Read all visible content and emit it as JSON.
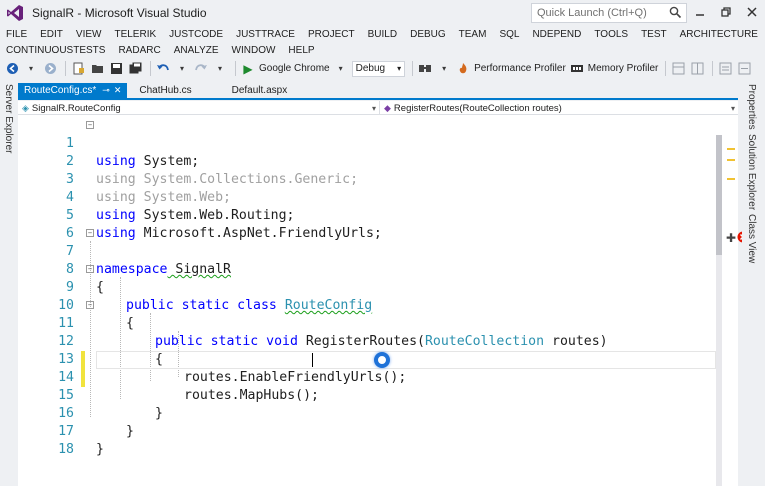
{
  "window": {
    "title": "SignalR - Microsoft Visual Studio",
    "quick_launch_placeholder": "Quick Launch (Ctrl+Q)",
    "controls": [
      "minimize",
      "restore",
      "close"
    ]
  },
  "menu": {
    "row1": [
      "FILE",
      "EDIT",
      "VIEW",
      "TELERIK",
      "JUSTCODE",
      "JUSTTRACE",
      "PROJECT",
      "BUILD",
      "DEBUG",
      "TEAM",
      "SQL",
      "NDEPEND",
      "TOOLS",
      "TEST",
      "ARCHITECTURE"
    ],
    "row2": [
      "CONTINUOUSTESTS",
      "RADARC",
      "ANALYZE",
      "WINDOW",
      "HELP"
    ]
  },
  "toolbar": {
    "browser": "Google Chrome",
    "config": "Debug",
    "perf_profiler": "Performance Profiler",
    "mem_profiler": "Memory Profiler"
  },
  "side_tabs": {
    "left": [
      "Server Explorer"
    ],
    "right": [
      "Properties",
      "Solution Explorer",
      "Class View"
    ]
  },
  "tabs": [
    {
      "label": "RouteConfig.cs*",
      "active": true
    },
    {
      "label": "ChatHub.cs",
      "active": false
    },
    {
      "label": "Default.aspx",
      "active": false
    }
  ],
  "nav": {
    "type_combo": "SignalR.RouteConfig",
    "member_combo": "RegisterRoutes(RouteCollection routes)"
  },
  "code": {
    "line_numbers": [
      "1",
      "2",
      "3",
      "4",
      "5",
      "6",
      "7",
      "8",
      "9",
      "10",
      "11",
      "12",
      "13",
      "14",
      "15",
      "16",
      "17",
      "18"
    ],
    "l1_kw": "using",
    "l1_rest": " System;",
    "l2": "using System.Collections.Generic;",
    "l3": "using System.Web;",
    "l4_kw": "using",
    "l4_rest": " System.Web.Routing;",
    "l5_kw": "using",
    "l5_rest": " Microsoft.AspNet.FriendlyUrls;",
    "l7_kw": "namespace",
    "l7_rest": " SignalR",
    "l8": "{",
    "l9_kw": "public static class",
    "l9_sp": " ",
    "l9_type": "RouteConfig",
    "l10": "{",
    "l11_kw": "public static void",
    "l11_name": " RegisterRoutes(",
    "l11_type": "RouteCollection",
    "l11_rest": " routes)",
    "l12": "{",
    "l13": "routes.EnableFriendlyUrls();",
    "l14": "routes.MapHubs();",
    "l15": "}",
    "l16": "}",
    "l17": "}"
  },
  "colors": {
    "accent": "#007acc",
    "keyword": "#0000ff",
    "type": "#2b91af",
    "change_bar": "#f1e33d",
    "error": "#e51400"
  }
}
